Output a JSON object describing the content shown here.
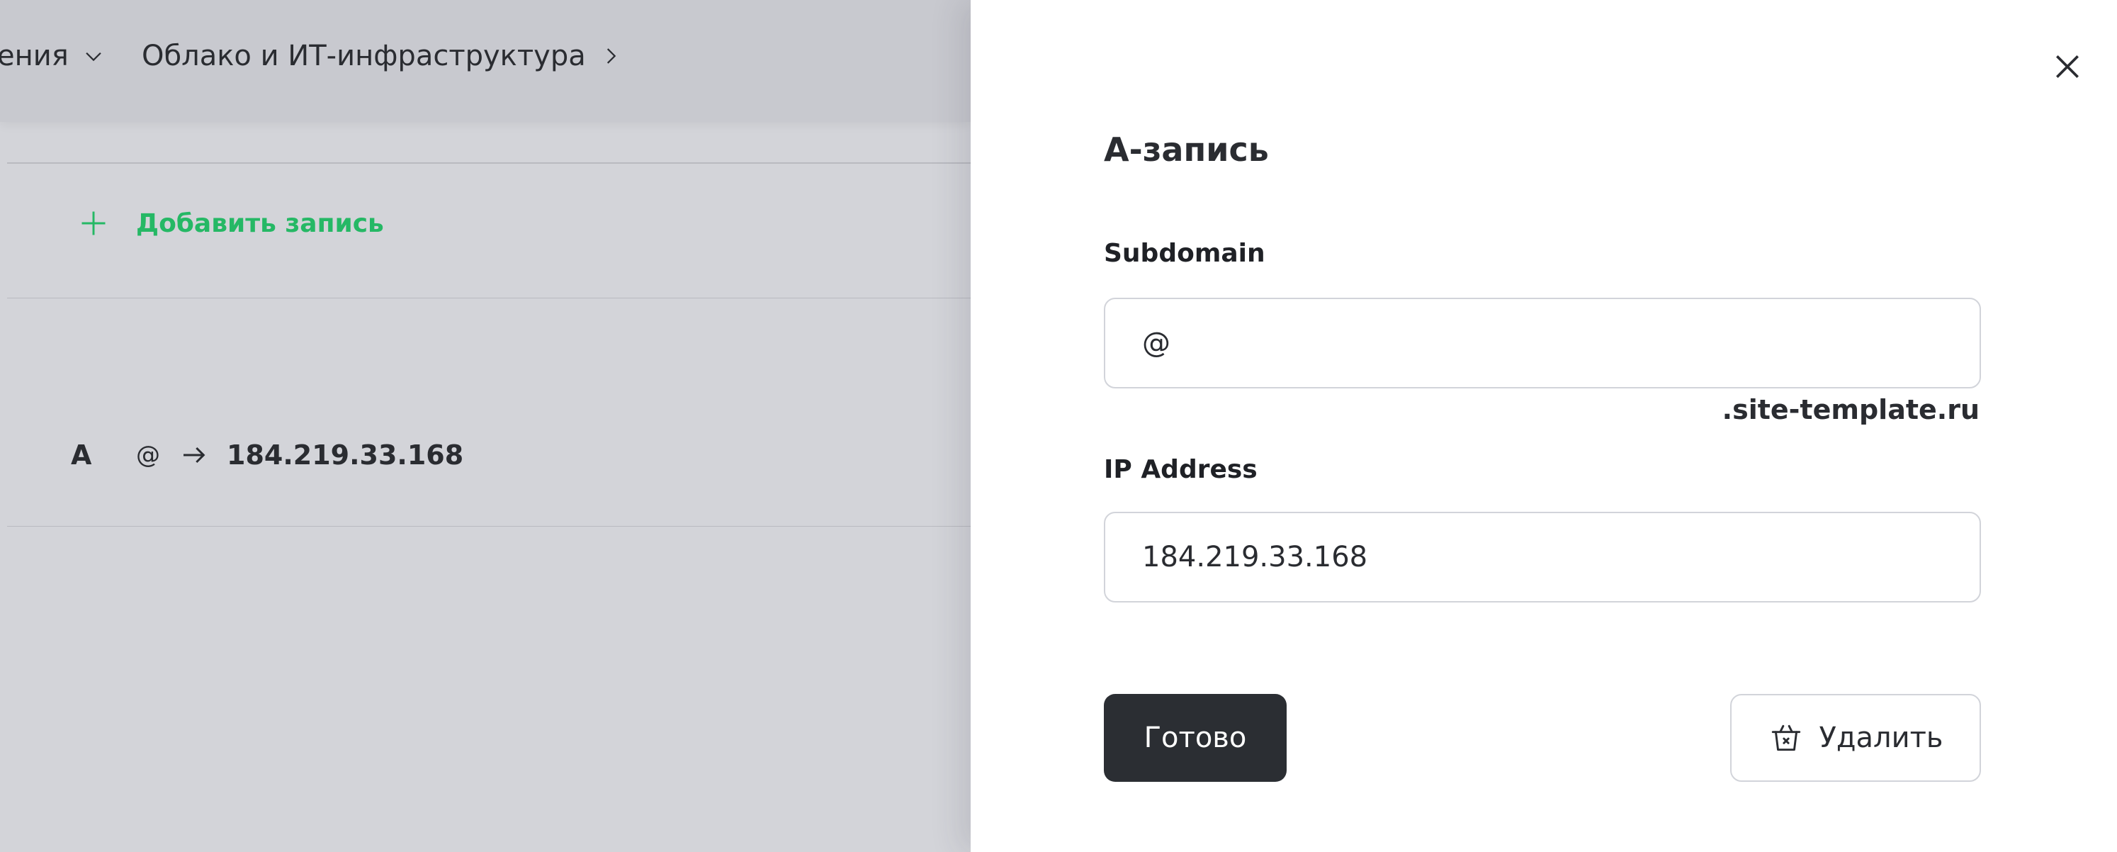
{
  "background": {
    "breadcrumbs": [
      {
        "label": "ения",
        "icon": "chevron-down-icon"
      },
      {
        "label": "Облако и ИТ-инфраструктура",
        "icon": "chevron-right-icon"
      }
    ],
    "add_record_label": "Добавить запись",
    "record": {
      "type": "A",
      "subdomain": "@",
      "value": "184.219.33.168"
    }
  },
  "panel": {
    "title": "A-запись",
    "subdomain_label": "Subdomain",
    "subdomain_value": "@",
    "domain_suffix": ".site-template.ru",
    "ip_label": "IP Address",
    "ip_value": "184.219.33.168",
    "done_label": "Готово",
    "delete_label": "Удалить"
  },
  "colors": {
    "accent": "#25b865",
    "primary_button": "#2b2e33",
    "overlay": "#d3d4d9"
  }
}
